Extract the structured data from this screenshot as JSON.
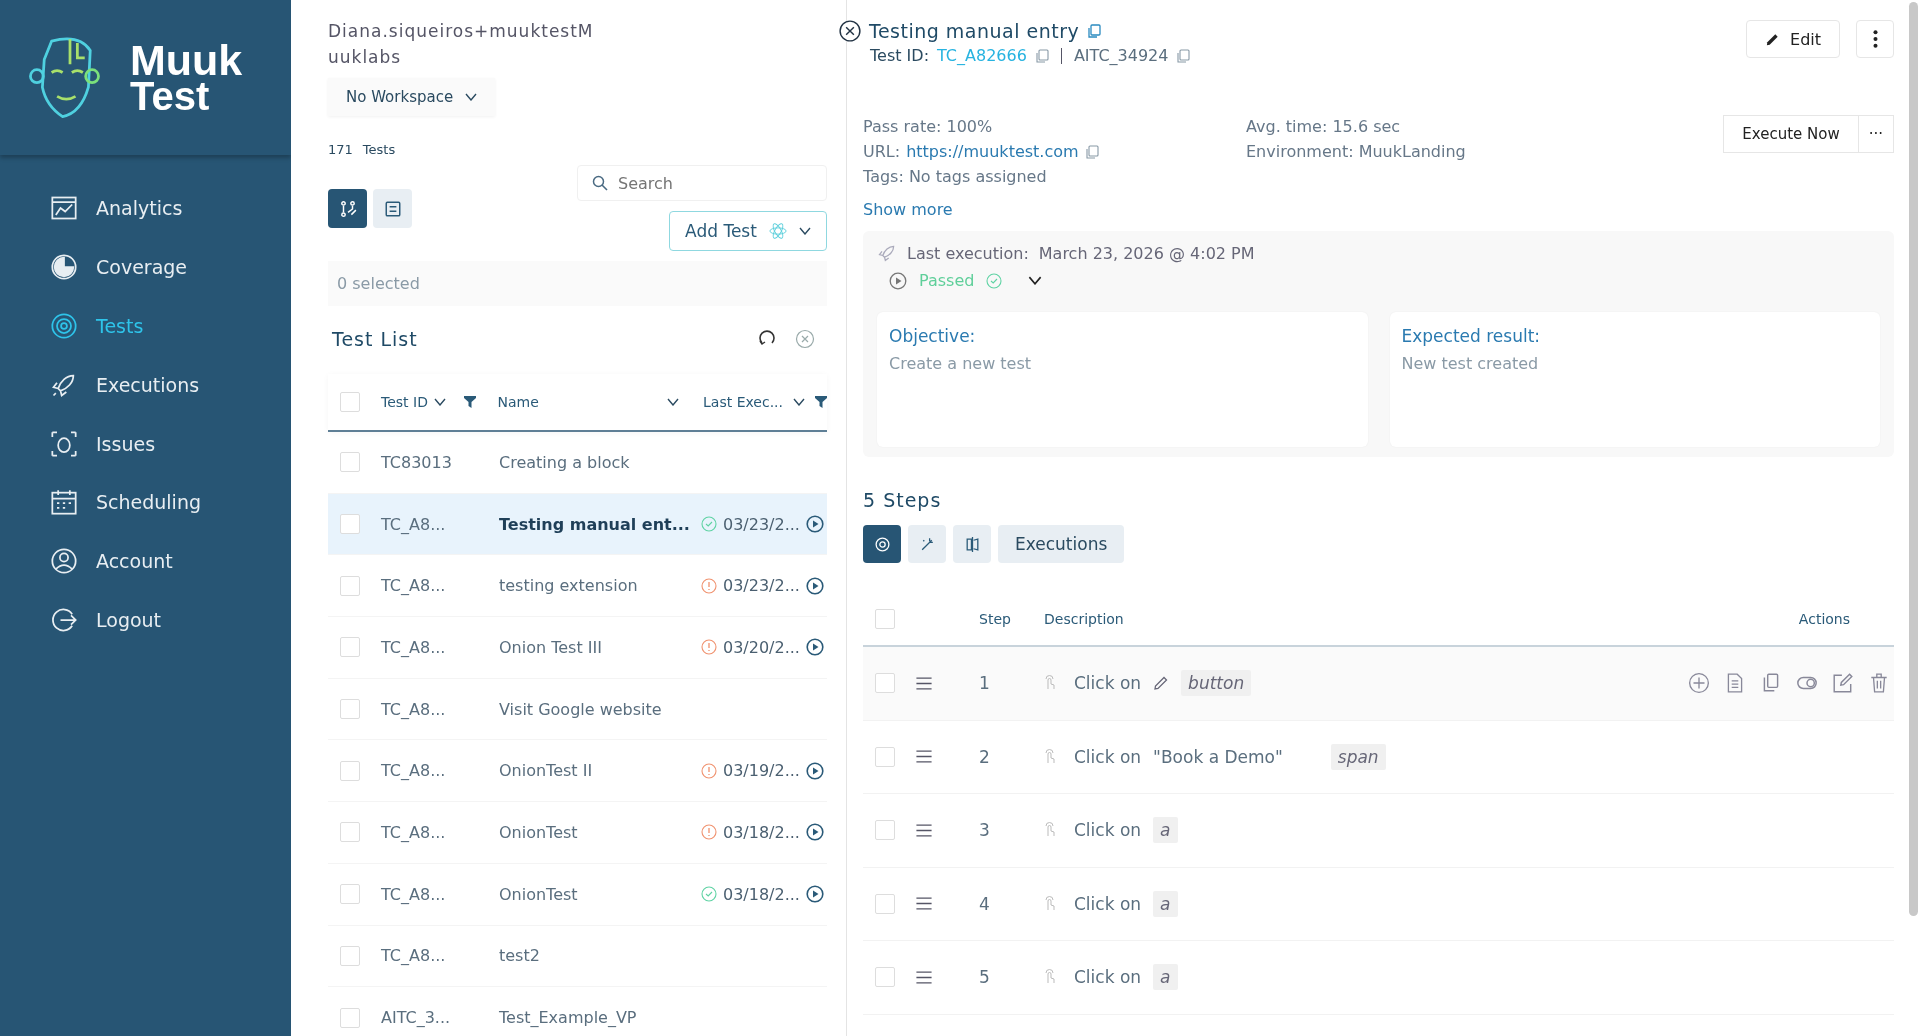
{
  "logo": {
    "line1": "Muuk",
    "line2": "Test"
  },
  "sidebar": {
    "items": [
      {
        "label": "Analytics",
        "selected": false
      },
      {
        "label": "Coverage",
        "selected": false
      },
      {
        "label": "Tests",
        "selected": true
      },
      {
        "label": "Executions",
        "selected": false
      },
      {
        "label": "Issues",
        "selected": false
      },
      {
        "label": "Scheduling",
        "selected": false
      },
      {
        "label": "Account",
        "selected": false
      },
      {
        "label": "Logout",
        "selected": false
      }
    ]
  },
  "list_panel": {
    "account": "Diana.siqueiros+muuktestMuuklabs",
    "workspace": "No Workspace",
    "test_count": "171",
    "test_count_label": "Tests",
    "views": [
      {
        "kind": "flow",
        "selected": true
      },
      {
        "kind": "list",
        "selected": false
      }
    ],
    "search": {
      "placeholder": "Search"
    },
    "add_button": "Add Test",
    "selection": "0 selected",
    "title": "Test List",
    "select_all": {
      "checked": false
    },
    "columns": [
      "Test ID",
      "Name",
      "Last Exec..."
    ],
    "rows": [
      {
        "id": "TC83013",
        "name": "Creating a block",
        "checked": false,
        "selected": false
      },
      {
        "id": "TC_A8...",
        "name": "Testing manual ent...",
        "kind": "passed",
        "date": "03/23/2...",
        "checked": false,
        "selected": true
      },
      {
        "id": "TC_A8...",
        "name": "testing extension",
        "kind": "failed",
        "date": "03/23/2...",
        "checked": false,
        "selected": false
      },
      {
        "id": "TC_A8...",
        "name": "Onion Test III",
        "kind": "failed",
        "date": "03/20/2...",
        "checked": false,
        "selected": false
      },
      {
        "id": "TC_A8...",
        "name": "Visit Google website",
        "checked": false,
        "selected": false
      },
      {
        "id": "TC_A8...",
        "name": "OnionTest II",
        "kind": "failed",
        "date": "03/19/2...",
        "checked": false,
        "selected": false
      },
      {
        "id": "TC_A8...",
        "name": "OnionTest",
        "kind": "failed",
        "date": "03/18/2...",
        "checked": false,
        "selected": false
      },
      {
        "id": "TC_A8...",
        "name": "OnionTest",
        "kind": "passed",
        "date": "03/18/2...",
        "checked": false,
        "selected": false
      },
      {
        "id": "TC_A8...",
        "name": "test2",
        "checked": false,
        "selected": false
      },
      {
        "id": "AITC_3...",
        "name": "Test_Example_VP",
        "checked": false,
        "selected": false
      }
    ]
  },
  "detail": {
    "title": "Testing manual entry",
    "test_id_label": "Test ID:",
    "test_id": "TC_A82666",
    "alt_id": "AITC_34924",
    "edit_button": "Edit",
    "pass_rate": "Pass rate: 100%",
    "url_label": "URL:",
    "url": "https://muuktest.com",
    "tags": "Tags: No tags assigned",
    "avg_time": "Avg. time: 15.6 sec",
    "environment": "Environment: MuukLanding",
    "execute_button": "Execute Now",
    "more_button": "···",
    "show_more": "Show more",
    "last_execution_label": "Last execution:",
    "last_execution": "March 23, 2026 @ 4:02 PM",
    "result": {
      "label": "Passed",
      "kind": "passed"
    },
    "objective_label": "Objective:",
    "objective": "Create a new test",
    "expected_label": "Expected result:",
    "expected": "New test created",
    "steps_title": "5 Steps",
    "step_tabs": [
      {
        "kind": "gear",
        "selected": true
      },
      {
        "kind": "wand",
        "selected": false
      },
      {
        "kind": "compare",
        "selected": false
      },
      {
        "kind": "text",
        "label": "Executions",
        "selected": false
      }
    ],
    "step_columns": {
      "step": "Step",
      "description": "Description",
      "actions": "Actions"
    },
    "select_all": {
      "checked": false
    },
    "steps": [
      {
        "number": "1",
        "action": "Click on",
        "editable": true,
        "tag": "button",
        "checked": false,
        "hovered": true
      },
      {
        "number": "2",
        "action": "Click on",
        "target": "\"Book a Demo\"",
        "editable": false,
        "tag": "span",
        "checked": false,
        "hovered": false
      },
      {
        "number": "3",
        "action": "Click on",
        "editable": false,
        "tag": "a",
        "checked": false,
        "hovered": false
      },
      {
        "number": "4",
        "action": "Click on",
        "editable": false,
        "tag": "a",
        "checked": false,
        "hovered": false
      },
      {
        "number": "5",
        "action": "Click on",
        "editable": false,
        "tag": "a",
        "checked": false,
        "hovered": false
      }
    ]
  }
}
